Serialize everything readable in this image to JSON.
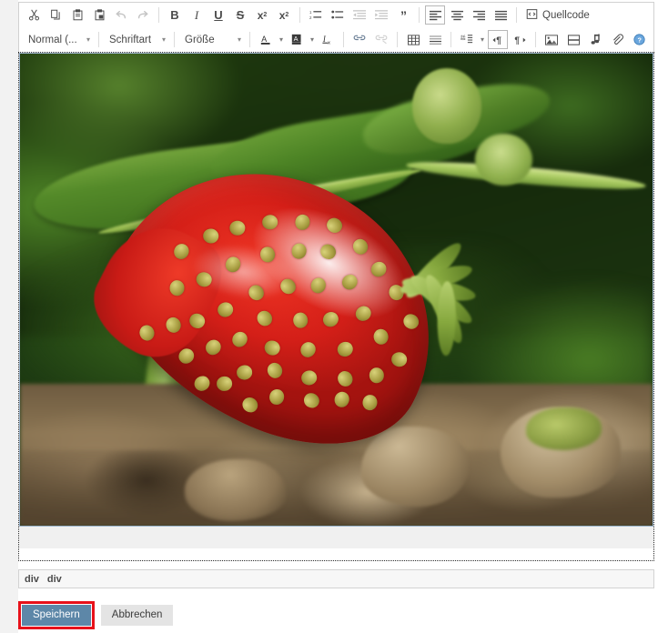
{
  "editor": {
    "toolbar_row1": [
      {
        "name": "cut",
        "icon": "scissors-icon",
        "label": "",
        "state": "enabled"
      },
      {
        "name": "copy",
        "icon": "copy-icon",
        "label": "",
        "state": "enabled"
      },
      {
        "name": "paste",
        "icon": "paste-icon",
        "label": "",
        "state": "enabled"
      },
      {
        "name": "paste-from-word",
        "icon": "paste-word-icon",
        "label": "",
        "state": "enabled"
      },
      {
        "name": "undo",
        "icon": "undo-arrow-icon",
        "label": "",
        "state": "disabled"
      },
      {
        "name": "redo",
        "icon": "redo-arrow-icon",
        "label": "",
        "state": "disabled"
      },
      {
        "name": "bold",
        "icon": "bold-icon",
        "label": "B",
        "state": "enabled"
      },
      {
        "name": "italic",
        "icon": "italic-icon",
        "label": "I",
        "state": "enabled"
      },
      {
        "name": "underline",
        "icon": "underline-icon",
        "label": "U",
        "state": "enabled"
      },
      {
        "name": "strikethrough",
        "icon": "strikethrough-icon",
        "label": "S",
        "state": "enabled"
      },
      {
        "name": "subscript",
        "icon": "subscript-icon",
        "label": "x",
        "state": "enabled"
      },
      {
        "name": "superscript",
        "icon": "superscript-icon",
        "label": "x",
        "state": "enabled"
      },
      {
        "name": "numbered-list",
        "icon": "numbered-list-icon",
        "label": "",
        "state": "enabled"
      },
      {
        "name": "bulleted-list",
        "icon": "bulleted-list-icon",
        "label": "",
        "state": "enabled"
      },
      {
        "name": "decrease-indent",
        "icon": "outdent-icon",
        "label": "",
        "state": "disabled"
      },
      {
        "name": "increase-indent",
        "icon": "indent-icon",
        "label": "",
        "state": "disabled"
      },
      {
        "name": "blockquote",
        "icon": "quote-icon",
        "label": "",
        "state": "enabled"
      },
      {
        "name": "align-left",
        "icon": "align-left-icon",
        "label": "",
        "state": "selected"
      },
      {
        "name": "align-center",
        "icon": "align-center-icon",
        "label": "",
        "state": "enabled"
      },
      {
        "name": "align-right",
        "icon": "align-right-icon",
        "label": "",
        "state": "enabled"
      },
      {
        "name": "align-justify",
        "icon": "align-justify-icon",
        "label": "",
        "state": "enabled"
      },
      {
        "name": "source-code",
        "icon": "source-code-icon",
        "label": "Quellcode",
        "state": "enabled"
      }
    ],
    "toolbar_row2": {
      "format_select": "Normal (...",
      "font_select": "Schriftart",
      "size_select": "Größe",
      "buttons": [
        {
          "name": "text-color",
          "icon": "text-color-icon",
          "label": "A",
          "state": "enabled"
        },
        {
          "name": "background-color",
          "icon": "background-color-icon",
          "label": "A",
          "state": "enabled"
        },
        {
          "name": "remove-format",
          "icon": "remove-format-icon",
          "label": "Ix",
          "state": "enabled"
        },
        {
          "name": "insert-link",
          "icon": "link-icon",
          "label": "",
          "state": "enabled"
        },
        {
          "name": "unlink",
          "icon": "unlink-icon",
          "label": "",
          "state": "disabled"
        },
        {
          "name": "insert-table",
          "icon": "table-icon",
          "label": "",
          "state": "enabled"
        },
        {
          "name": "horizontal-rule",
          "icon": "horizontal-rule-icon",
          "label": "",
          "state": "enabled"
        },
        {
          "name": "language",
          "icon": "language-icon",
          "label": "",
          "state": "enabled"
        },
        {
          "name": "text-direction-ltr",
          "icon": "direction-ltr-icon",
          "label": "",
          "state": "selected"
        },
        {
          "name": "text-direction-rtl",
          "icon": "direction-rtl-icon",
          "label": "",
          "state": "enabled"
        },
        {
          "name": "insert-image",
          "icon": "image-icon",
          "label": "",
          "state": "enabled"
        },
        {
          "name": "insert-flash",
          "icon": "flash-icon",
          "label": "",
          "state": "enabled"
        },
        {
          "name": "insert-audio",
          "icon": "music-note-icon",
          "label": "",
          "state": "enabled"
        },
        {
          "name": "insert-attachment",
          "icon": "paperclip-icon",
          "label": "",
          "state": "enabled"
        },
        {
          "name": "help",
          "icon": "help-icon",
          "label": "?",
          "state": "enabled"
        }
      ]
    },
    "content": {
      "image_alt": "Red strawberry ripening on soil with green strawberry plant leaves",
      "selected": true
    },
    "breadcrumb": [
      "div",
      "div"
    ]
  },
  "footer": {
    "save_label": "Speichern",
    "cancel_label": "Abbrechen",
    "highlight_color": "#e8111a",
    "save_bg": "#5d87a8",
    "cancel_bg": "#e4e4e4"
  }
}
